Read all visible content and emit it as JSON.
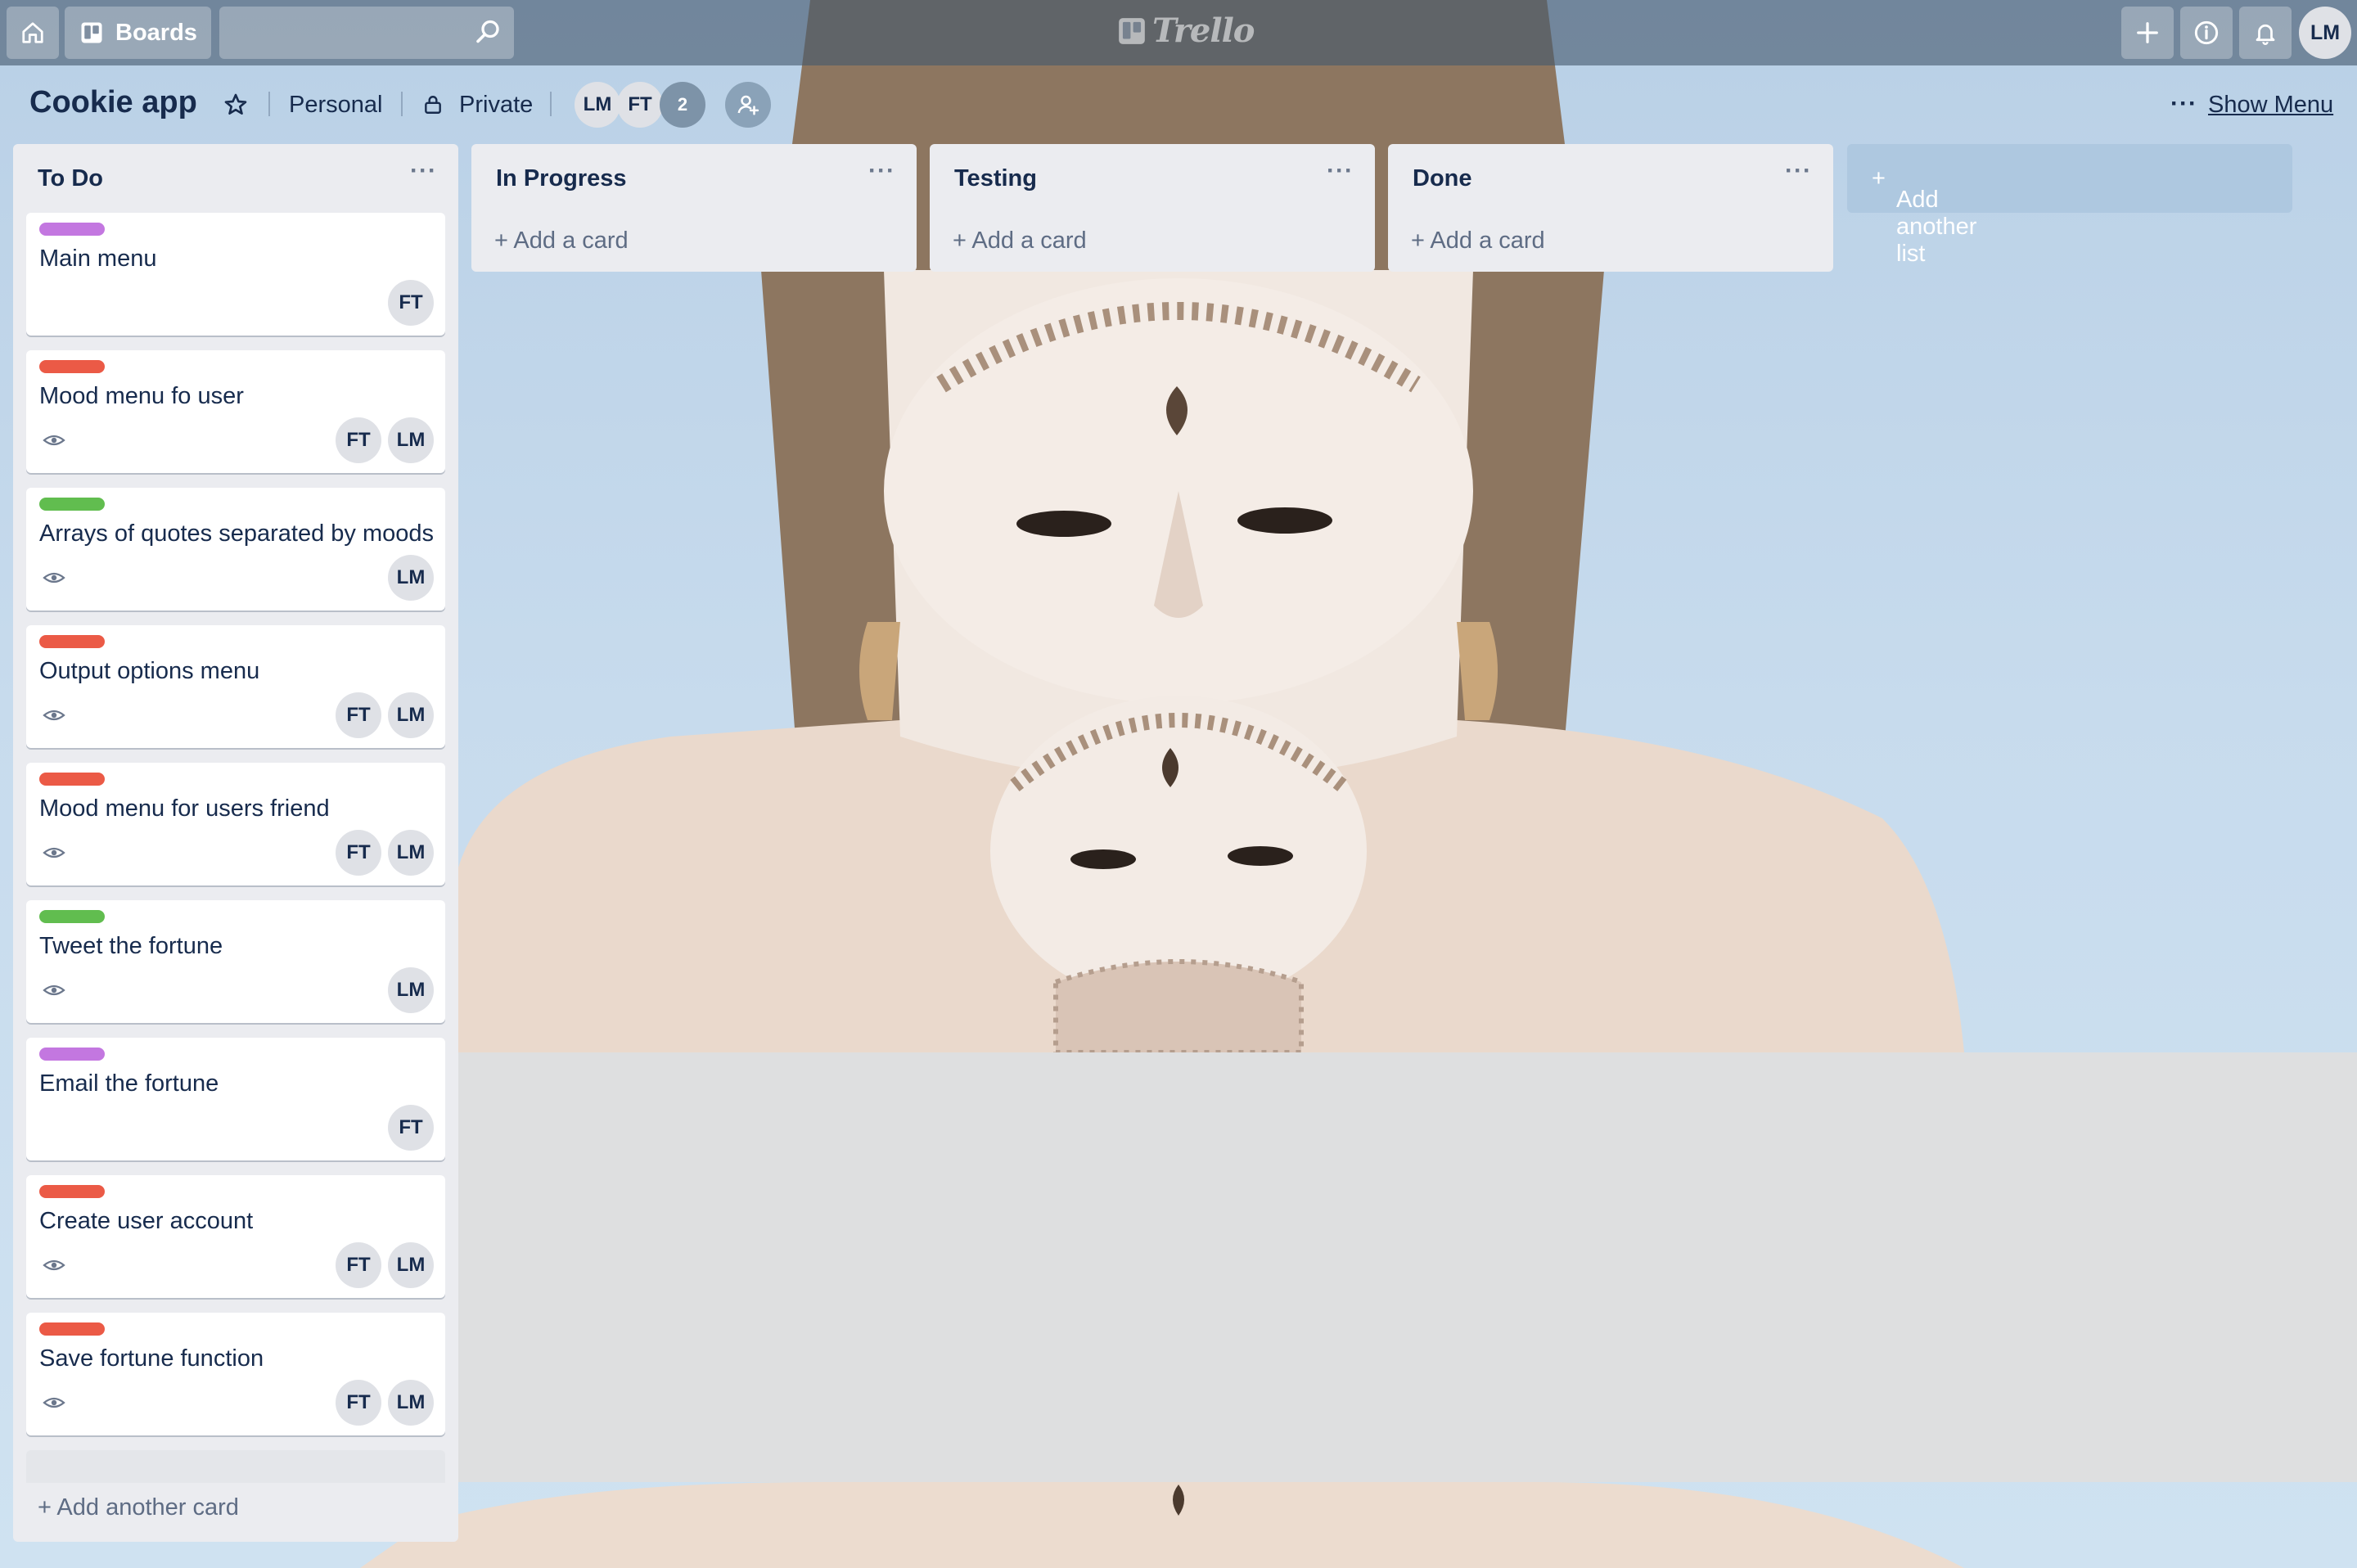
{
  "header": {
    "boards_label": "Boards",
    "logo_text": "Trello",
    "user_initials": "LM"
  },
  "board": {
    "title": "Cookie app",
    "team": "Personal",
    "visibility": "Private",
    "members": [
      "LM",
      "FT"
    ],
    "extra_members_count": "2",
    "show_menu_label": "Show Menu",
    "more_dots": "···"
  },
  "lists": [
    {
      "title": "To Do",
      "add_label": "Add another card",
      "cards": [
        {
          "title": "Main menu",
          "label_color": "#c377e0",
          "watched": false,
          "members": [
            "FT"
          ]
        },
        {
          "title": "Mood menu fo user",
          "label_color": "#eb5a46",
          "watched": true,
          "members": [
            "FT",
            "LM"
          ]
        },
        {
          "title": "Arrays of quotes separated by moods",
          "label_color": "#61bd4f",
          "watched": true,
          "members": [
            "LM"
          ]
        },
        {
          "title": "Output options menu",
          "label_color": "#eb5a46",
          "watched": true,
          "members": [
            "FT",
            "LM"
          ]
        },
        {
          "title": "Mood menu for users friend",
          "label_color": "#eb5a46",
          "watched": true,
          "members": [
            "FT",
            "LM"
          ]
        },
        {
          "title": "Tweet the fortune",
          "label_color": "#61bd4f",
          "watched": true,
          "members": [
            "LM"
          ]
        },
        {
          "title": "Email the fortune",
          "label_color": "#c377e0",
          "watched": false,
          "members": [
            "FT"
          ]
        },
        {
          "title": "Create user account",
          "label_color": "#eb5a46",
          "watched": true,
          "members": [
            "FT",
            "LM"
          ]
        },
        {
          "title": "Save fortune function",
          "label_color": "#eb5a46",
          "watched": true,
          "members": [
            "FT",
            "LM"
          ]
        }
      ]
    },
    {
      "title": "In Progress",
      "add_label": "Add a card",
      "cards": []
    },
    {
      "title": "Testing",
      "add_label": "Add a card",
      "cards": []
    },
    {
      "title": "Done",
      "add_label": "Add a card",
      "cards": []
    }
  ],
  "add_list_label": "Add another list",
  "colors": {
    "label_purple": "#c377e0",
    "label_red": "#eb5a46",
    "label_green": "#61bd4f"
  }
}
